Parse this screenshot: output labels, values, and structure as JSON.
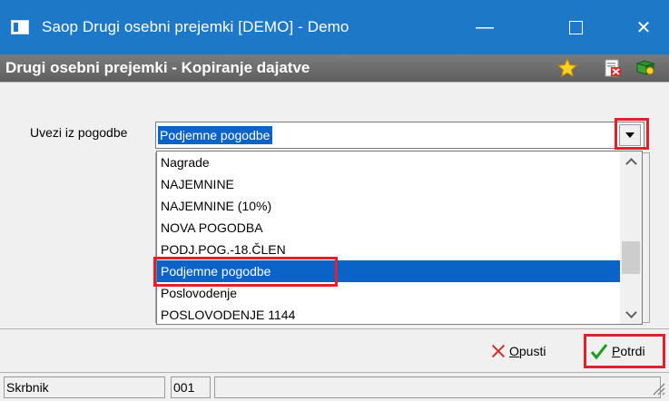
{
  "window": {
    "title": "Saop  Drugi osebni prejemki [DEMO] - Demo",
    "controls": {
      "minimize": "—",
      "close": "✕"
    }
  },
  "header": {
    "title": "Drugi osebni prejemki - Kopiranje dajatve",
    "icons": [
      "star-icon",
      "pdf-export-icon",
      "help-book-icon"
    ]
  },
  "form": {
    "label": "Uvezi iz pogodbe",
    "selected_value": "Podjemne pogodbe"
  },
  "dropdown": {
    "items": [
      "Nagrade",
      "NAJEMNINE",
      "NAJEMNINE (10%)",
      "NOVA POGODBA",
      "PODJ.POG.-18.ČLEN",
      "Podjemne pogodbe",
      "Poslovodenje",
      "POSLOVODENJE 1144"
    ],
    "selected_index": 5
  },
  "buttons": {
    "cancel": {
      "underlined": "O",
      "rest": "pusti"
    },
    "confirm": {
      "underlined": "P",
      "rest": "otrdi"
    }
  },
  "statusbar": {
    "user": "Skrbnik",
    "code": "001",
    "extra": ""
  },
  "colors": {
    "titlebar": "#1e78c8",
    "selection": "#0a64c8",
    "highlight": "#e0202a"
  }
}
